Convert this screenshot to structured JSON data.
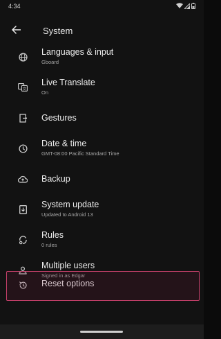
{
  "status_bar": {
    "time": "4:34"
  },
  "app_bar": {
    "back_icon": "arrow-left-icon",
    "title": "System"
  },
  "items": [
    {
      "id": "languages",
      "icon": "globe-icon",
      "title": "Languages & input",
      "subtitle": "Gboard"
    },
    {
      "id": "live-translate",
      "icon": "translate-icon",
      "title": "Live Translate",
      "subtitle": "On"
    },
    {
      "id": "gestures",
      "icon": "gestures-icon",
      "title": "Gestures",
      "subtitle": ""
    },
    {
      "id": "date-time",
      "icon": "clock-icon",
      "title": "Date & time",
      "subtitle": "GMT-08:00 Pacific Standard Time"
    },
    {
      "id": "backup",
      "icon": "cloud-upload-icon",
      "title": "Backup",
      "subtitle": ""
    },
    {
      "id": "system-update",
      "icon": "system-update-icon",
      "title": "System update",
      "subtitle": "Updated to Android 13"
    },
    {
      "id": "rules",
      "icon": "rules-icon",
      "title": "Rules",
      "subtitle": "0 rules"
    },
    {
      "id": "multiple-users",
      "icon": "users-icon",
      "title": "Multiple users",
      "subtitle": "Signed in as Edgar"
    },
    {
      "id": "reset-options",
      "icon": "reset-icon",
      "title": "Reset options",
      "subtitle": ""
    }
  ],
  "colors": {
    "background": "#121212",
    "highlight_border": "#c4406a",
    "text_primary": "#ececec",
    "text_secondary": "#a8a8a8"
  }
}
